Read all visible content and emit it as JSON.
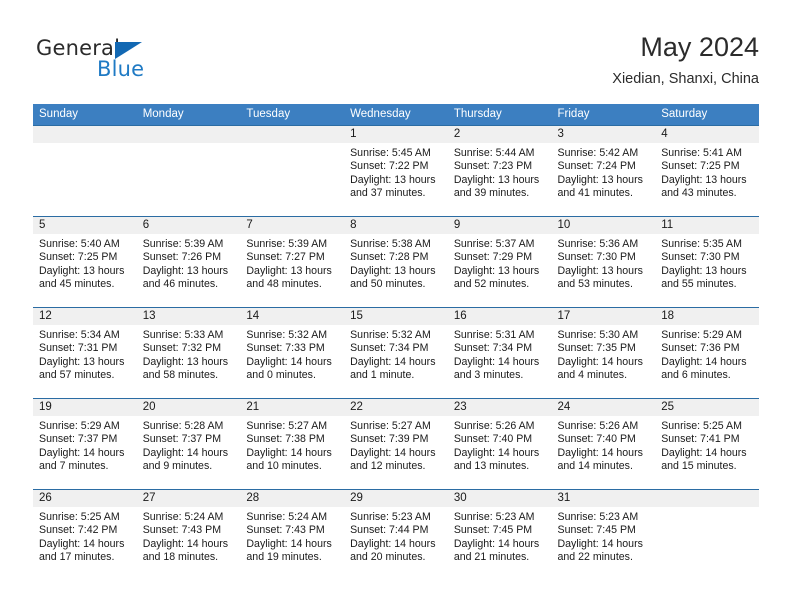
{
  "brand": {
    "name_top": "General",
    "name_bottom": "Blue",
    "triangle_color": "#1268b3",
    "blue_color": "#1f7ac4"
  },
  "header": {
    "title": "May 2024",
    "subtitle": "Xiedian, Shanxi, China"
  },
  "theme": {
    "header_row_bg": "#3c7fc1",
    "week_separator": "#2b6ca3",
    "date_band_bg": "#f0f0f0"
  },
  "labels": {
    "sunrise_prefix": "Sunrise:",
    "sunset_prefix": "Sunset:",
    "daylight_prefix": "Daylight:"
  },
  "day_headers": [
    "Sunday",
    "Monday",
    "Tuesday",
    "Wednesday",
    "Thursday",
    "Friday",
    "Saturday"
  ],
  "weeks": [
    [
      {
        "empty": true
      },
      {
        "empty": true
      },
      {
        "empty": true
      },
      {
        "date": "1",
        "sunrise": "Sunrise: 5:45 AM",
        "sunset": "Sunset: 7:22 PM",
        "daylight_line1": "Daylight: 13 hours",
        "daylight_line2": "and 37 minutes."
      },
      {
        "date": "2",
        "sunrise": "Sunrise: 5:44 AM",
        "sunset": "Sunset: 7:23 PM",
        "daylight_line1": "Daylight: 13 hours",
        "daylight_line2": "and 39 minutes."
      },
      {
        "date": "3",
        "sunrise": "Sunrise: 5:42 AM",
        "sunset": "Sunset: 7:24 PM",
        "daylight_line1": "Daylight: 13 hours",
        "daylight_line2": "and 41 minutes."
      },
      {
        "date": "4",
        "sunrise": "Sunrise: 5:41 AM",
        "sunset": "Sunset: 7:25 PM",
        "daylight_line1": "Daylight: 13 hours",
        "daylight_line2": "and 43 minutes."
      }
    ],
    [
      {
        "date": "5",
        "sunrise": "Sunrise: 5:40 AM",
        "sunset": "Sunset: 7:25 PM",
        "daylight_line1": "Daylight: 13 hours",
        "daylight_line2": "and 45 minutes."
      },
      {
        "date": "6",
        "sunrise": "Sunrise: 5:39 AM",
        "sunset": "Sunset: 7:26 PM",
        "daylight_line1": "Daylight: 13 hours",
        "daylight_line2": "and 46 minutes."
      },
      {
        "date": "7",
        "sunrise": "Sunrise: 5:39 AM",
        "sunset": "Sunset: 7:27 PM",
        "daylight_line1": "Daylight: 13 hours",
        "daylight_line2": "and 48 minutes."
      },
      {
        "date": "8",
        "sunrise": "Sunrise: 5:38 AM",
        "sunset": "Sunset: 7:28 PM",
        "daylight_line1": "Daylight: 13 hours",
        "daylight_line2": "and 50 minutes."
      },
      {
        "date": "9",
        "sunrise": "Sunrise: 5:37 AM",
        "sunset": "Sunset: 7:29 PM",
        "daylight_line1": "Daylight: 13 hours",
        "daylight_line2": "and 52 minutes."
      },
      {
        "date": "10",
        "sunrise": "Sunrise: 5:36 AM",
        "sunset": "Sunset: 7:30 PM",
        "daylight_line1": "Daylight: 13 hours",
        "daylight_line2": "and 53 minutes."
      },
      {
        "date": "11",
        "sunrise": "Sunrise: 5:35 AM",
        "sunset": "Sunset: 7:30 PM",
        "daylight_line1": "Daylight: 13 hours",
        "daylight_line2": "and 55 minutes."
      }
    ],
    [
      {
        "date": "12",
        "sunrise": "Sunrise: 5:34 AM",
        "sunset": "Sunset: 7:31 PM",
        "daylight_line1": "Daylight: 13 hours",
        "daylight_line2": "and 57 minutes."
      },
      {
        "date": "13",
        "sunrise": "Sunrise: 5:33 AM",
        "sunset": "Sunset: 7:32 PM",
        "daylight_line1": "Daylight: 13 hours",
        "daylight_line2": "and 58 minutes."
      },
      {
        "date": "14",
        "sunrise": "Sunrise: 5:32 AM",
        "sunset": "Sunset: 7:33 PM",
        "daylight_line1": "Daylight: 14 hours",
        "daylight_line2": "and 0 minutes."
      },
      {
        "date": "15",
        "sunrise": "Sunrise: 5:32 AM",
        "sunset": "Sunset: 7:34 PM",
        "daylight_line1": "Daylight: 14 hours",
        "daylight_line2": "and 1 minute."
      },
      {
        "date": "16",
        "sunrise": "Sunrise: 5:31 AM",
        "sunset": "Sunset: 7:34 PM",
        "daylight_line1": "Daylight: 14 hours",
        "daylight_line2": "and 3 minutes."
      },
      {
        "date": "17",
        "sunrise": "Sunrise: 5:30 AM",
        "sunset": "Sunset: 7:35 PM",
        "daylight_line1": "Daylight: 14 hours",
        "daylight_line2": "and 4 minutes."
      },
      {
        "date": "18",
        "sunrise": "Sunrise: 5:29 AM",
        "sunset": "Sunset: 7:36 PM",
        "daylight_line1": "Daylight: 14 hours",
        "daylight_line2": "and 6 minutes."
      }
    ],
    [
      {
        "date": "19",
        "sunrise": "Sunrise: 5:29 AM",
        "sunset": "Sunset: 7:37 PM",
        "daylight_line1": "Daylight: 14 hours",
        "daylight_line2": "and 7 minutes."
      },
      {
        "date": "20",
        "sunrise": "Sunrise: 5:28 AM",
        "sunset": "Sunset: 7:37 PM",
        "daylight_line1": "Daylight: 14 hours",
        "daylight_line2": "and 9 minutes."
      },
      {
        "date": "21",
        "sunrise": "Sunrise: 5:27 AM",
        "sunset": "Sunset: 7:38 PM",
        "daylight_line1": "Daylight: 14 hours",
        "daylight_line2": "and 10 minutes."
      },
      {
        "date": "22",
        "sunrise": "Sunrise: 5:27 AM",
        "sunset": "Sunset: 7:39 PM",
        "daylight_line1": "Daylight: 14 hours",
        "daylight_line2": "and 12 minutes."
      },
      {
        "date": "23",
        "sunrise": "Sunrise: 5:26 AM",
        "sunset": "Sunset: 7:40 PM",
        "daylight_line1": "Daylight: 14 hours",
        "daylight_line2": "and 13 minutes."
      },
      {
        "date": "24",
        "sunrise": "Sunrise: 5:26 AM",
        "sunset": "Sunset: 7:40 PM",
        "daylight_line1": "Daylight: 14 hours",
        "daylight_line2": "and 14 minutes."
      },
      {
        "date": "25",
        "sunrise": "Sunrise: 5:25 AM",
        "sunset": "Sunset: 7:41 PM",
        "daylight_line1": "Daylight: 14 hours",
        "daylight_line2": "and 15 minutes."
      }
    ],
    [
      {
        "date": "26",
        "sunrise": "Sunrise: 5:25 AM",
        "sunset": "Sunset: 7:42 PM",
        "daylight_line1": "Daylight: 14 hours",
        "daylight_line2": "and 17 minutes."
      },
      {
        "date": "27",
        "sunrise": "Sunrise: 5:24 AM",
        "sunset": "Sunset: 7:43 PM",
        "daylight_line1": "Daylight: 14 hours",
        "daylight_line2": "and 18 minutes."
      },
      {
        "date": "28",
        "sunrise": "Sunrise: 5:24 AM",
        "sunset": "Sunset: 7:43 PM",
        "daylight_line1": "Daylight: 14 hours",
        "daylight_line2": "and 19 minutes."
      },
      {
        "date": "29",
        "sunrise": "Sunrise: 5:23 AM",
        "sunset": "Sunset: 7:44 PM",
        "daylight_line1": "Daylight: 14 hours",
        "daylight_line2": "and 20 minutes."
      },
      {
        "date": "30",
        "sunrise": "Sunrise: 5:23 AM",
        "sunset": "Sunset: 7:45 PM",
        "daylight_line1": "Daylight: 14 hours",
        "daylight_line2": "and 21 minutes."
      },
      {
        "date": "31",
        "sunrise": "Sunrise: 5:23 AM",
        "sunset": "Sunset: 7:45 PM",
        "daylight_line1": "Daylight: 14 hours",
        "daylight_line2": "and 22 minutes."
      },
      {
        "empty": true
      }
    ]
  ]
}
